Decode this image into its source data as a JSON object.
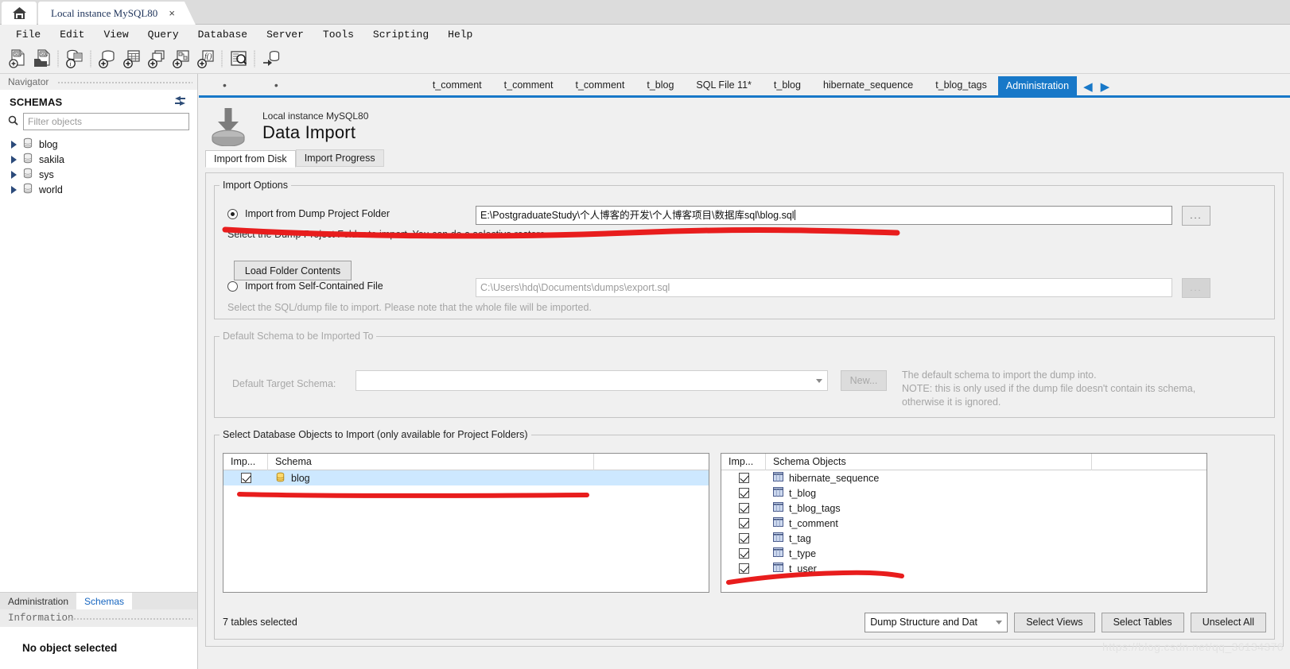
{
  "window": {
    "home_tab_icon": "home-icon",
    "instance_tab_label": "Local instance MySQL80",
    "instance_tab_close": "×"
  },
  "menu": {
    "items": [
      "File",
      "Edit",
      "View",
      "Query",
      "Database",
      "Server",
      "Tools",
      "Scripting",
      "Help"
    ]
  },
  "toolbar": {
    "icons": [
      "new-sql-tab-icon",
      "open-sql-script-icon",
      "server-info-icon",
      "new-schema-icon",
      "new-table-icon",
      "new-view-icon",
      "new-stored-procedure-icon",
      "new-function-icon",
      "search-data-icon",
      "reconnect-server-icon"
    ]
  },
  "navigator": {
    "caption": "Navigator",
    "schemas_title": "SCHEMAS",
    "refresh_icon": "refresh-icon",
    "search_icon": "search-icon",
    "filter_placeholder": "Filter objects",
    "filter_value": "",
    "schemas": [
      "blog",
      "sakila",
      "sys",
      "world"
    ],
    "tabs": [
      {
        "label": "Administration",
        "active": false
      },
      {
        "label": "Schemas",
        "active": true
      }
    ],
    "information_caption": "Information",
    "information_text": "No object selected"
  },
  "editor_tabs": {
    "items": [
      {
        "label": "•",
        "active": false,
        "dot": true
      },
      {
        "label": "•",
        "active": false,
        "dot": true
      },
      {
        "label": "t_comment",
        "active": false
      },
      {
        "label": "t_comment",
        "active": false
      },
      {
        "label": "t_comment",
        "active": false
      },
      {
        "label": "t_blog",
        "active": false
      },
      {
        "label": "SQL File 11*",
        "active": false
      },
      {
        "label": "t_blog",
        "active": false
      },
      {
        "label": "hibernate_sequence",
        "active": false
      },
      {
        "label": "t_blog_tags",
        "active": false
      },
      {
        "label": "Administration",
        "active": true
      }
    ],
    "prev_arrow": "◀",
    "next_arrow": "▶",
    "accent_color": "#1878c8"
  },
  "page": {
    "icon": "data-import-icon",
    "subtitle": "Local instance MySQL80",
    "title": "Data Import",
    "subtabs": [
      {
        "label": "Import from Disk",
        "active": true
      },
      {
        "label": "Import Progress",
        "active": false
      }
    ]
  },
  "import_options": {
    "legend": "Import Options",
    "dump_folder": {
      "label": "Import from Dump Project Folder",
      "selected": true,
      "path": "E:\\PostgraduateStudy\\个人博客的开发\\个人博客项目\\数据库sql\\blog.sql",
      "browse_label": "...",
      "hint": "Select the Dump Project Folder to import. You can do a selective restore.",
      "load_button": "Load Folder Contents"
    },
    "self_contained": {
      "label": "Import from Self-Contained File",
      "selected": false,
      "path": "C:\\Users\\hdq\\Documents\\dumps\\export.sql",
      "browse_label": "...",
      "hint": "Select the SQL/dump file to import. Please note that the whole file will be imported."
    }
  },
  "default_schema": {
    "legend": "Default Schema to be Imported To",
    "label": "Default Target Schema:",
    "value": "",
    "new_button": "New...",
    "note_lines": [
      "The default schema to import the dump into.",
      "NOTE: this is only used if the dump file doesn't contain its schema,",
      "otherwise it is ignored."
    ]
  },
  "objects": {
    "legend": "Select Database Objects to Import (only available for Project Folders)",
    "left_table": {
      "headers": [
        "Imp...",
        "Schema"
      ],
      "rows": [
        {
          "checked": true,
          "name": "blog",
          "icon": "schema-icon",
          "selected": true
        }
      ]
    },
    "right_table": {
      "headers": [
        "Imp...",
        "Schema Objects"
      ],
      "rows": [
        {
          "checked": true,
          "name": "hibernate_sequence",
          "icon": "table-icon"
        },
        {
          "checked": true,
          "name": "t_blog",
          "icon": "table-icon"
        },
        {
          "checked": true,
          "name": "t_blog_tags",
          "icon": "table-icon"
        },
        {
          "checked": true,
          "name": "t_comment",
          "icon": "table-icon"
        },
        {
          "checked": true,
          "name": "t_tag",
          "icon": "table-icon"
        },
        {
          "checked": true,
          "name": "t_type",
          "icon": "table-icon"
        },
        {
          "checked": true,
          "name": "t_user",
          "icon": "table-icon"
        }
      ]
    },
    "selected_count_text": "7 tables selected",
    "dump_type_value": "Dump Structure and Dat",
    "buttons": [
      "Select Views",
      "Select Tables",
      "Unselect All"
    ]
  },
  "watermark": "https://blog.csdn.net/qq_36134376",
  "colors": {
    "accent": "#1878c8",
    "selection": "#cde8ff",
    "annotation": "#e81d1d",
    "window_bg": "#f0f0f0"
  }
}
